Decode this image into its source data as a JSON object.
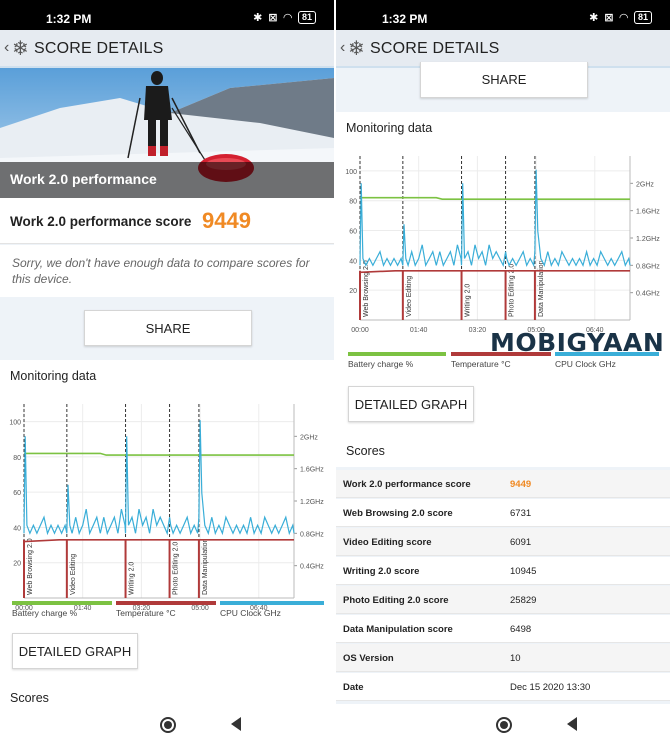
{
  "status": {
    "time": "1:32 PM",
    "battery": "81"
  },
  "appbar": {
    "title": "SCORE DETAILS"
  },
  "left": {
    "banner": "Work 2.0 performance",
    "score_label": "Work 2.0 performance score",
    "score_value": "9449",
    "sorry": "Sorry, we don't have enough data to compare scores for this device.",
    "share": "SHARE",
    "monitoring_title": "Monitoring data",
    "detailed": "DETAILED GRAPH",
    "scores_title": "Scores"
  },
  "right": {
    "share": "SHARE",
    "monitoring_title": "Monitoring data",
    "detailed": "DETAILED GRAPH",
    "watermark": "MOBIGYAAN",
    "scores_title": "Scores",
    "rows": [
      {
        "label": "Work 2.0 performance score",
        "value": "9449",
        "highlight": true
      },
      {
        "label": "Web Browsing 2.0 score",
        "value": "6731"
      },
      {
        "label": "Video Editing score",
        "value": "6091"
      },
      {
        "label": "Writing 2.0 score",
        "value": "10945"
      },
      {
        "label": "Photo Editing 2.0 score",
        "value": "25829"
      },
      {
        "label": "Data Manipulation score",
        "value": "6498"
      },
      {
        "label": "OS Version",
        "value": "10"
      },
      {
        "label": "Date",
        "value": "Dec 15 2020 13:30"
      }
    ]
  },
  "legend": [
    "Battery charge %",
    "Temperature °C",
    "CPU Clock GHz"
  ],
  "colors": {
    "battery": "#7cc242",
    "temperature": "#b03a3a",
    "cpu": "#3aaed8",
    "accent": "#f08a24"
  },
  "chart_data": {
    "type": "line",
    "title": "Monitoring data",
    "x_ticks": [
      "00:00",
      "01:40",
      "03:20",
      "05:00",
      "06:40"
    ],
    "x_tick_minutes": [
      0,
      100,
      200,
      300,
      400
    ],
    "xlim_minutes": [
      0,
      460
    ],
    "y_left_ticks": [
      20,
      40,
      60,
      80,
      100
    ],
    "ylim_left": [
      0,
      110
    ],
    "y_right_ticks": [
      "0.4GHz",
      "0.8GHz",
      "1.2GHz",
      "1.6GHz",
      "2GHz"
    ],
    "y_right_values": [
      0.4,
      0.8,
      1.2,
      1.6,
      2.0
    ],
    "segments": [
      {
        "name": "Web Browsing 2.0",
        "start_minute": 0
      },
      {
        "name": "Video Editing",
        "start_minute": 73
      },
      {
        "name": "Writing 2.0",
        "start_minute": 173
      },
      {
        "name": "Photo Editing 2.0",
        "start_minute": 248
      },
      {
        "name": "Data Manipulation",
        "start_minute": 298
      }
    ],
    "series": [
      {
        "name": "Battery charge %",
        "x": [
          0,
          130,
          140,
          460
        ],
        "y": [
          82,
          82,
          81,
          81
        ]
      },
      {
        "name": "Temperature °C",
        "x": [
          0,
          60,
          460
        ],
        "y": [
          32,
          33,
          33
        ]
      },
      {
        "name": "CPU Clock GHz",
        "x": [
          0,
          2,
          5,
          10,
          16,
          22,
          28,
          34,
          40,
          46,
          52,
          58,
          64,
          70,
          73,
          75,
          78,
          82,
          88,
          94,
          100,
          106,
          112,
          118,
          124,
          130,
          136,
          142,
          148,
          154,
          160,
          166,
          172,
          173,
          175,
          178,
          184,
          190,
          196,
          202,
          208,
          214,
          220,
          226,
          232,
          238,
          244,
          248,
          250,
          254,
          260,
          266,
          272,
          278,
          284,
          290,
          296,
          298,
          300,
          303,
          308,
          314,
          320,
          326,
          332,
          338,
          344,
          350,
          356,
          362,
          368,
          374,
          380,
          386,
          392,
          398,
          404,
          410,
          416,
          422,
          428,
          434,
          440,
          446,
          452,
          458,
          460
        ],
        "y": [
          0.8,
          2.0,
          0.9,
          0.8,
          0.9,
          0.8,
          0.9,
          1.0,
          0.8,
          0.9,
          0.8,
          0.9,
          0.8,
          0.9,
          0.8,
          1.4,
          0.9,
          0.8,
          1.0,
          0.8,
          0.9,
          1.1,
          0.8,
          0.9,
          1.0,
          0.8,
          1.0,
          0.8,
          0.9,
          1.0,
          0.8,
          1.1,
          0.9,
          0.8,
          2.0,
          0.9,
          1.0,
          0.8,
          1.1,
          0.9,
          1.0,
          0.8,
          1.1,
          0.9,
          1.0,
          0.9,
          0.8,
          1.0,
          0.9,
          0.8,
          0.9,
          0.8,
          0.9,
          1.0,
          0.8,
          0.9,
          0.8,
          1.0,
          2.2,
          1.3,
          0.9,
          0.8,
          1.0,
          0.8,
          0.9,
          0.8,
          1.0,
          0.9,
          0.8,
          0.9,
          0.8,
          0.9,
          0.8,
          1.0,
          0.8,
          0.9,
          0.8,
          1.0,
          0.9,
          0.8,
          0.9,
          0.8,
          0.9,
          1.0,
          0.8,
          0.9,
          0.8
        ]
      }
    ],
    "grid": true,
    "legend": "bottom"
  }
}
